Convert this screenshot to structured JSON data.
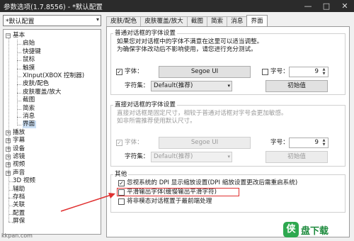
{
  "window": {
    "title": "参数选项(1.7.8556) - *默认配置",
    "buttons": [
      "—",
      "□",
      "✕"
    ]
  },
  "preset": {
    "value": "*默认配置"
  },
  "tree": {
    "items": [
      {
        "label": "基本",
        "level": 0,
        "expander": "−"
      },
      {
        "label": "启始",
        "level": 1
      },
      {
        "label": "快捷键",
        "level": 1
      },
      {
        "label": "鼠标",
        "level": 1
      },
      {
        "label": "触摸",
        "level": 1
      },
      {
        "label": "XInput(XBOX 控制器)",
        "level": 1
      },
      {
        "label": "皮肤/配色",
        "level": 1
      },
      {
        "label": "皮肤覆盖/放大",
        "level": 1
      },
      {
        "label": "截图",
        "level": 1
      },
      {
        "label": "简索",
        "level": 1
      },
      {
        "label": "消息",
        "level": 1
      },
      {
        "label": "界面",
        "level": 1,
        "selected": true
      },
      {
        "label": "播放",
        "level": 0,
        "expander": "+"
      },
      {
        "label": "字幕",
        "level": 0,
        "expander": "+"
      },
      {
        "label": "设备",
        "level": 0,
        "expander": "+"
      },
      {
        "label": "滤镜",
        "level": 0,
        "expander": "+"
      },
      {
        "label": "视频",
        "level": 0,
        "expander": "+"
      },
      {
        "label": "声音",
        "level": 0,
        "expander": "+"
      },
      {
        "label": "3D 视频",
        "level": 0
      },
      {
        "label": "辅助",
        "level": 0
      },
      {
        "label": "存档",
        "level": 0
      },
      {
        "label": "关联",
        "level": 0
      },
      {
        "label": "配置",
        "level": 0
      },
      {
        "label": "屏保",
        "level": 0
      }
    ]
  },
  "tabs": [
    {
      "label": "皮肤/配色",
      "active": false
    },
    {
      "label": "皮肤覆盖/放大",
      "active": false
    },
    {
      "label": "截图",
      "active": false
    },
    {
      "label": "简索",
      "active": false
    },
    {
      "label": "消息",
      "active": false
    },
    {
      "label": "界面",
      "active": true
    }
  ],
  "normal_font": {
    "title": "普通对话框的字体设置",
    "desc1": "如果您对对话框中的字体不满意在这里可以适当调整。",
    "desc2": "为确保字体改动后不影响使用，请您进行充分测试。",
    "font_label": "字体：",
    "font_checked": true,
    "font_value": "Segoe UI",
    "size_label": "字号：",
    "size_checked": false,
    "size_value": "9",
    "charset_label": "字符集：",
    "charset_value": "Default(推荐)",
    "reset_label": "初始值"
  },
  "direct_font": {
    "title": "直接对话框的字体设置",
    "desc1": "直接对话框是固定尺寸，相较于普通对话框对字号会更加敏感。",
    "desc2": "如非所需推荐使用默认尺寸。",
    "font_label": "字体：",
    "font_value": "Segoe UI",
    "size_label": "字号：",
    "size_value": "9",
    "charset_label": "字符集：",
    "charset_value": "Default(推荐)",
    "reset_label": "初始值"
  },
  "other": {
    "title": "其他",
    "options": [
      {
        "label": "忽视系统的 DPI 显示缩放设置(DPI 缩放设置更改后需重启系统)",
        "checked": true
      },
      {
        "label": "平滑输出字体(缓慢输出平滑字符)",
        "checked": false
      },
      {
        "label": "将非模态对话框置于最前端处理",
        "checked": false
      }
    ]
  },
  "watermark": {
    "logo": "侠",
    "text": "盘下载",
    "url": "kkpan.com"
  },
  "colors": {
    "highlight": "#e03030",
    "selected": "#cce0f5",
    "watermark": "#1c8a3c"
  }
}
